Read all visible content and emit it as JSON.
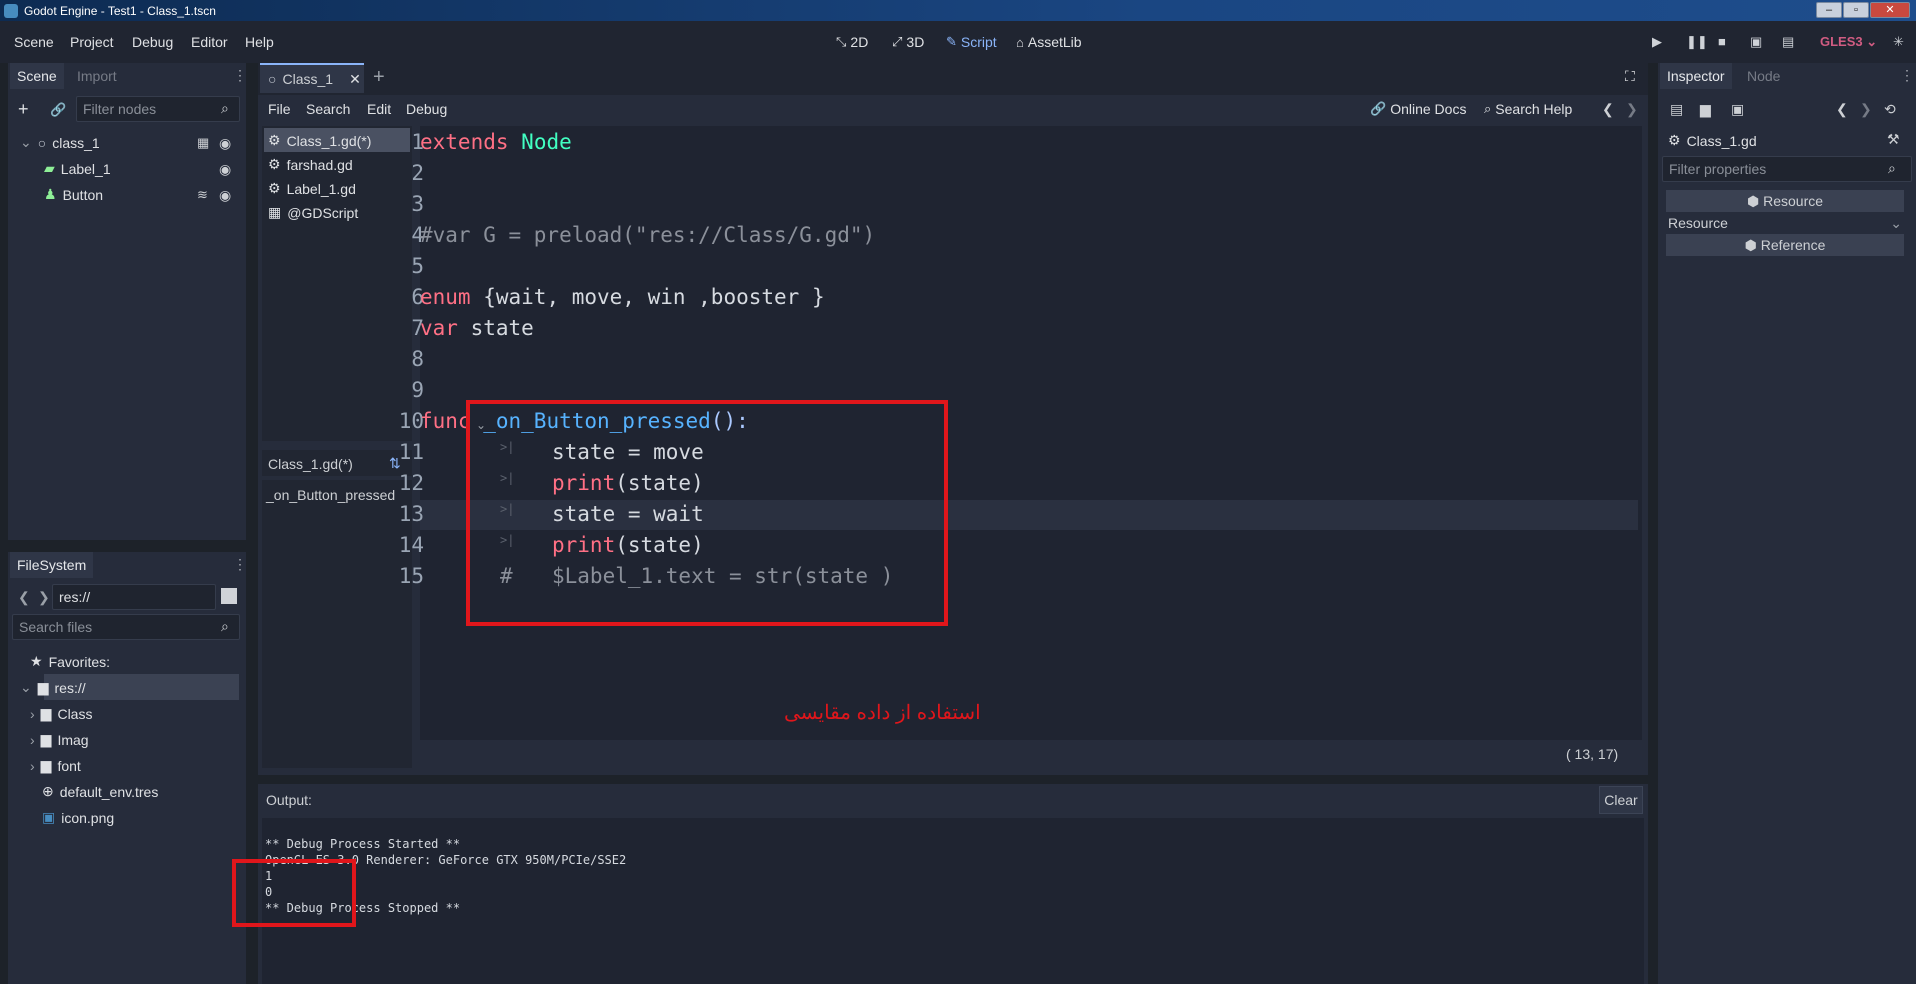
{
  "window": {
    "title": "Godot Engine - Test1 - Class_1.tscn"
  },
  "menu": [
    "Scene",
    "Project",
    "Debug",
    "Editor",
    "Help"
  ],
  "workspace": [
    {
      "icon": "2d-icon",
      "label": "2D"
    },
    {
      "icon": "3d-icon",
      "label": "3D"
    },
    {
      "icon": "script-icon",
      "label": "Script"
    },
    {
      "icon": "assetlib-icon",
      "label": "AssetLib"
    }
  ],
  "renderer": "GLES3",
  "scene_dock": {
    "tabs": [
      "Scene",
      "Import"
    ],
    "filter_placeholder": "Filter nodes",
    "nodes": [
      "class_1",
      "Label_1",
      "Button"
    ]
  },
  "filesystem": {
    "tab": "FileSystem",
    "path": "res://",
    "search_placeholder": "Search files",
    "favorites": "Favorites:",
    "items": [
      "res://",
      "Class",
      "Imag",
      "font",
      "default_env.tres",
      "icon.png"
    ]
  },
  "editor_tabs": {
    "active": "Class_1"
  },
  "script_menu": [
    "File",
    "Search",
    "Edit",
    "Debug"
  ],
  "script_toolbar": {
    "docs": "Online Docs",
    "search_help": "Search Help"
  },
  "script_list": [
    "Class_1.gd(*)",
    "farshad.gd",
    "Label_1.gd",
    "@GDScript"
  ],
  "method_panel": {
    "title": "Class_1.gd(*)",
    "methods": [
      "_on_Button_pressed"
    ]
  },
  "code": {
    "line_numbers": [
      "1",
      "2",
      "3",
      "4",
      "5",
      "6",
      "7",
      "8",
      "9",
      "10",
      "11",
      "12",
      "13",
      "14",
      "15"
    ],
    "l1a": "extends",
    "l1b": "Node",
    "l4": "#var G = preload(\"res://Class/G.gd\")",
    "l6a": "enum",
    "l6b": "{wait, move, win ,booster }",
    "l7a": "var",
    "l7b": "state",
    "l10a": "func",
    "l10b": "_on_Button_pressed",
    "l10c": "():",
    "l11": "state = move",
    "l12a": "print",
    "l12b": "(state)",
    "l13": "state = wait",
    "l14a": "print",
    "l14b": "(state)",
    "l15a": "#",
    "l15b": "$Label_1.text = str(state )"
  },
  "annotation": "استفاده از داده مقایسی",
  "cursor_pos": "( 13, 17)",
  "output": {
    "label": "Output:",
    "clear": "Clear",
    "lines": [
      "** Debug Process Started **",
      "OpenGL ES 3.0 Renderer: GeForce GTX 950M/PCIe/SSE2",
      "1",
      "0",
      "** Debug Process Stopped **"
    ]
  },
  "inspector": {
    "tabs": [
      "Inspector",
      "Node"
    ],
    "file": "Class_1.gd",
    "filter_placeholder": "Filter properties",
    "resource_btn": "Resource",
    "resource_label": "Resource",
    "reference_btn": "Reference"
  },
  "colors": {
    "accent": "#8ab4f8",
    "highlight": "#e0161b"
  }
}
